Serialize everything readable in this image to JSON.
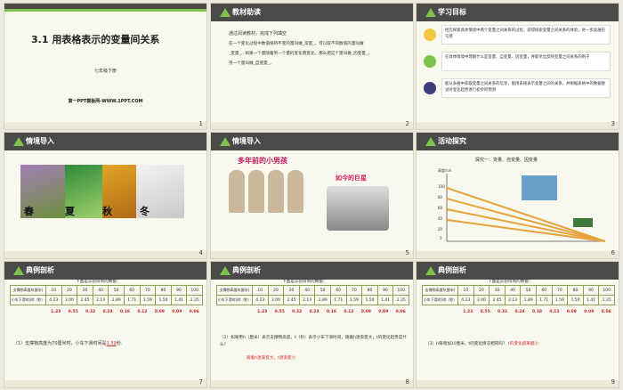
{
  "slides": [
    {
      "num": "1",
      "title": "3.1  用表格表示的变量间关系",
      "subtitle": "七年级下册",
      "footer": "第一PPT模板网-WWW.1PPT.COM"
    },
    {
      "num": "2",
      "section": "教材助读",
      "lines": [
        "通过阅读教材，完成下列填空",
        "在一个变化过程中数值保持不变的量叫做_常量_，可以取不同数值的量叫做",
        "_变量_，如果一个量随着另一个量的变化而变化，那么把这个量叫做_因变量_，",
        "另一个量叫做_自变量_。"
      ]
    },
    {
      "num": "3",
      "section": "学习目标",
      "goals": [
        "经历探索具体情境中两个变量之间关系的过程，获得探索变量之间关系的体验，进一步发展符号感",
        "在具体情境中理解什么是变量、自变量、因变量，并能举出反映变量之间关系的例子",
        "能从表格中获取变量之间关系的信息，能用表格表示变量之间的关系，并根据表格中的数据尝试对变化趋势进行初步的预测"
      ]
    },
    {
      "num": "4",
      "section": "情境导入",
      "seasons": [
        "春",
        "夏",
        "秋",
        "冬"
      ]
    },
    {
      "num": "5",
      "section": "情境导入",
      "caption1": "多年前的小男孩",
      "caption2": "如今的巨星"
    },
    {
      "num": "6",
      "section": "活动探究",
      "explore": "探究一：变量、自变量、因变量",
      "axis_label": "高度/cm",
      "ticks": [
        "100",
        "80",
        "60",
        "40",
        "20",
        "0"
      ]
    },
    {
      "num": "7",
      "section": "典例剖析",
      "caption": "下面是实验得到的数据：",
      "q": "（1）支撑物高度为70厘米时，小车下滑时间是",
      "ans": "1.59",
      "unit": "秒."
    },
    {
      "num": "8",
      "section": "典例剖析",
      "caption": "下面是实验得到的数据：",
      "q": "（2）如果用h（厘米）表示支撑物高度，t（秒）表示小车下滑时间，随着h逐渐变大，t的变化趋势是什么？",
      "ans": "随着h逐渐变大，t逐渐变小"
    },
    {
      "num": "9",
      "section": "典例剖析",
      "caption": "下面是实验得到的数据：",
      "q": "（3）h每增加10厘米，t的变化情况相同吗？",
      "ans": "t的变化越来越小"
    }
  ],
  "table": {
    "row1_label": "支撑物高度h(厘米)",
    "row2_label": "小车下滑时间t（秒）",
    "h": [
      "10",
      "20",
      "30",
      "40",
      "50",
      "60",
      "70",
      "80",
      "90",
      "100"
    ],
    "t": [
      "4.23",
      "3.00",
      "2.45",
      "2.13",
      "1.89",
      "1.71",
      "1.59",
      "1.50",
      "1.41",
      "1.35"
    ],
    "diffs": [
      "1.23",
      "0.55",
      "0.32",
      "0.24",
      "0.18",
      "0.12",
      "0.09",
      "0.09",
      "0.06"
    ]
  }
}
